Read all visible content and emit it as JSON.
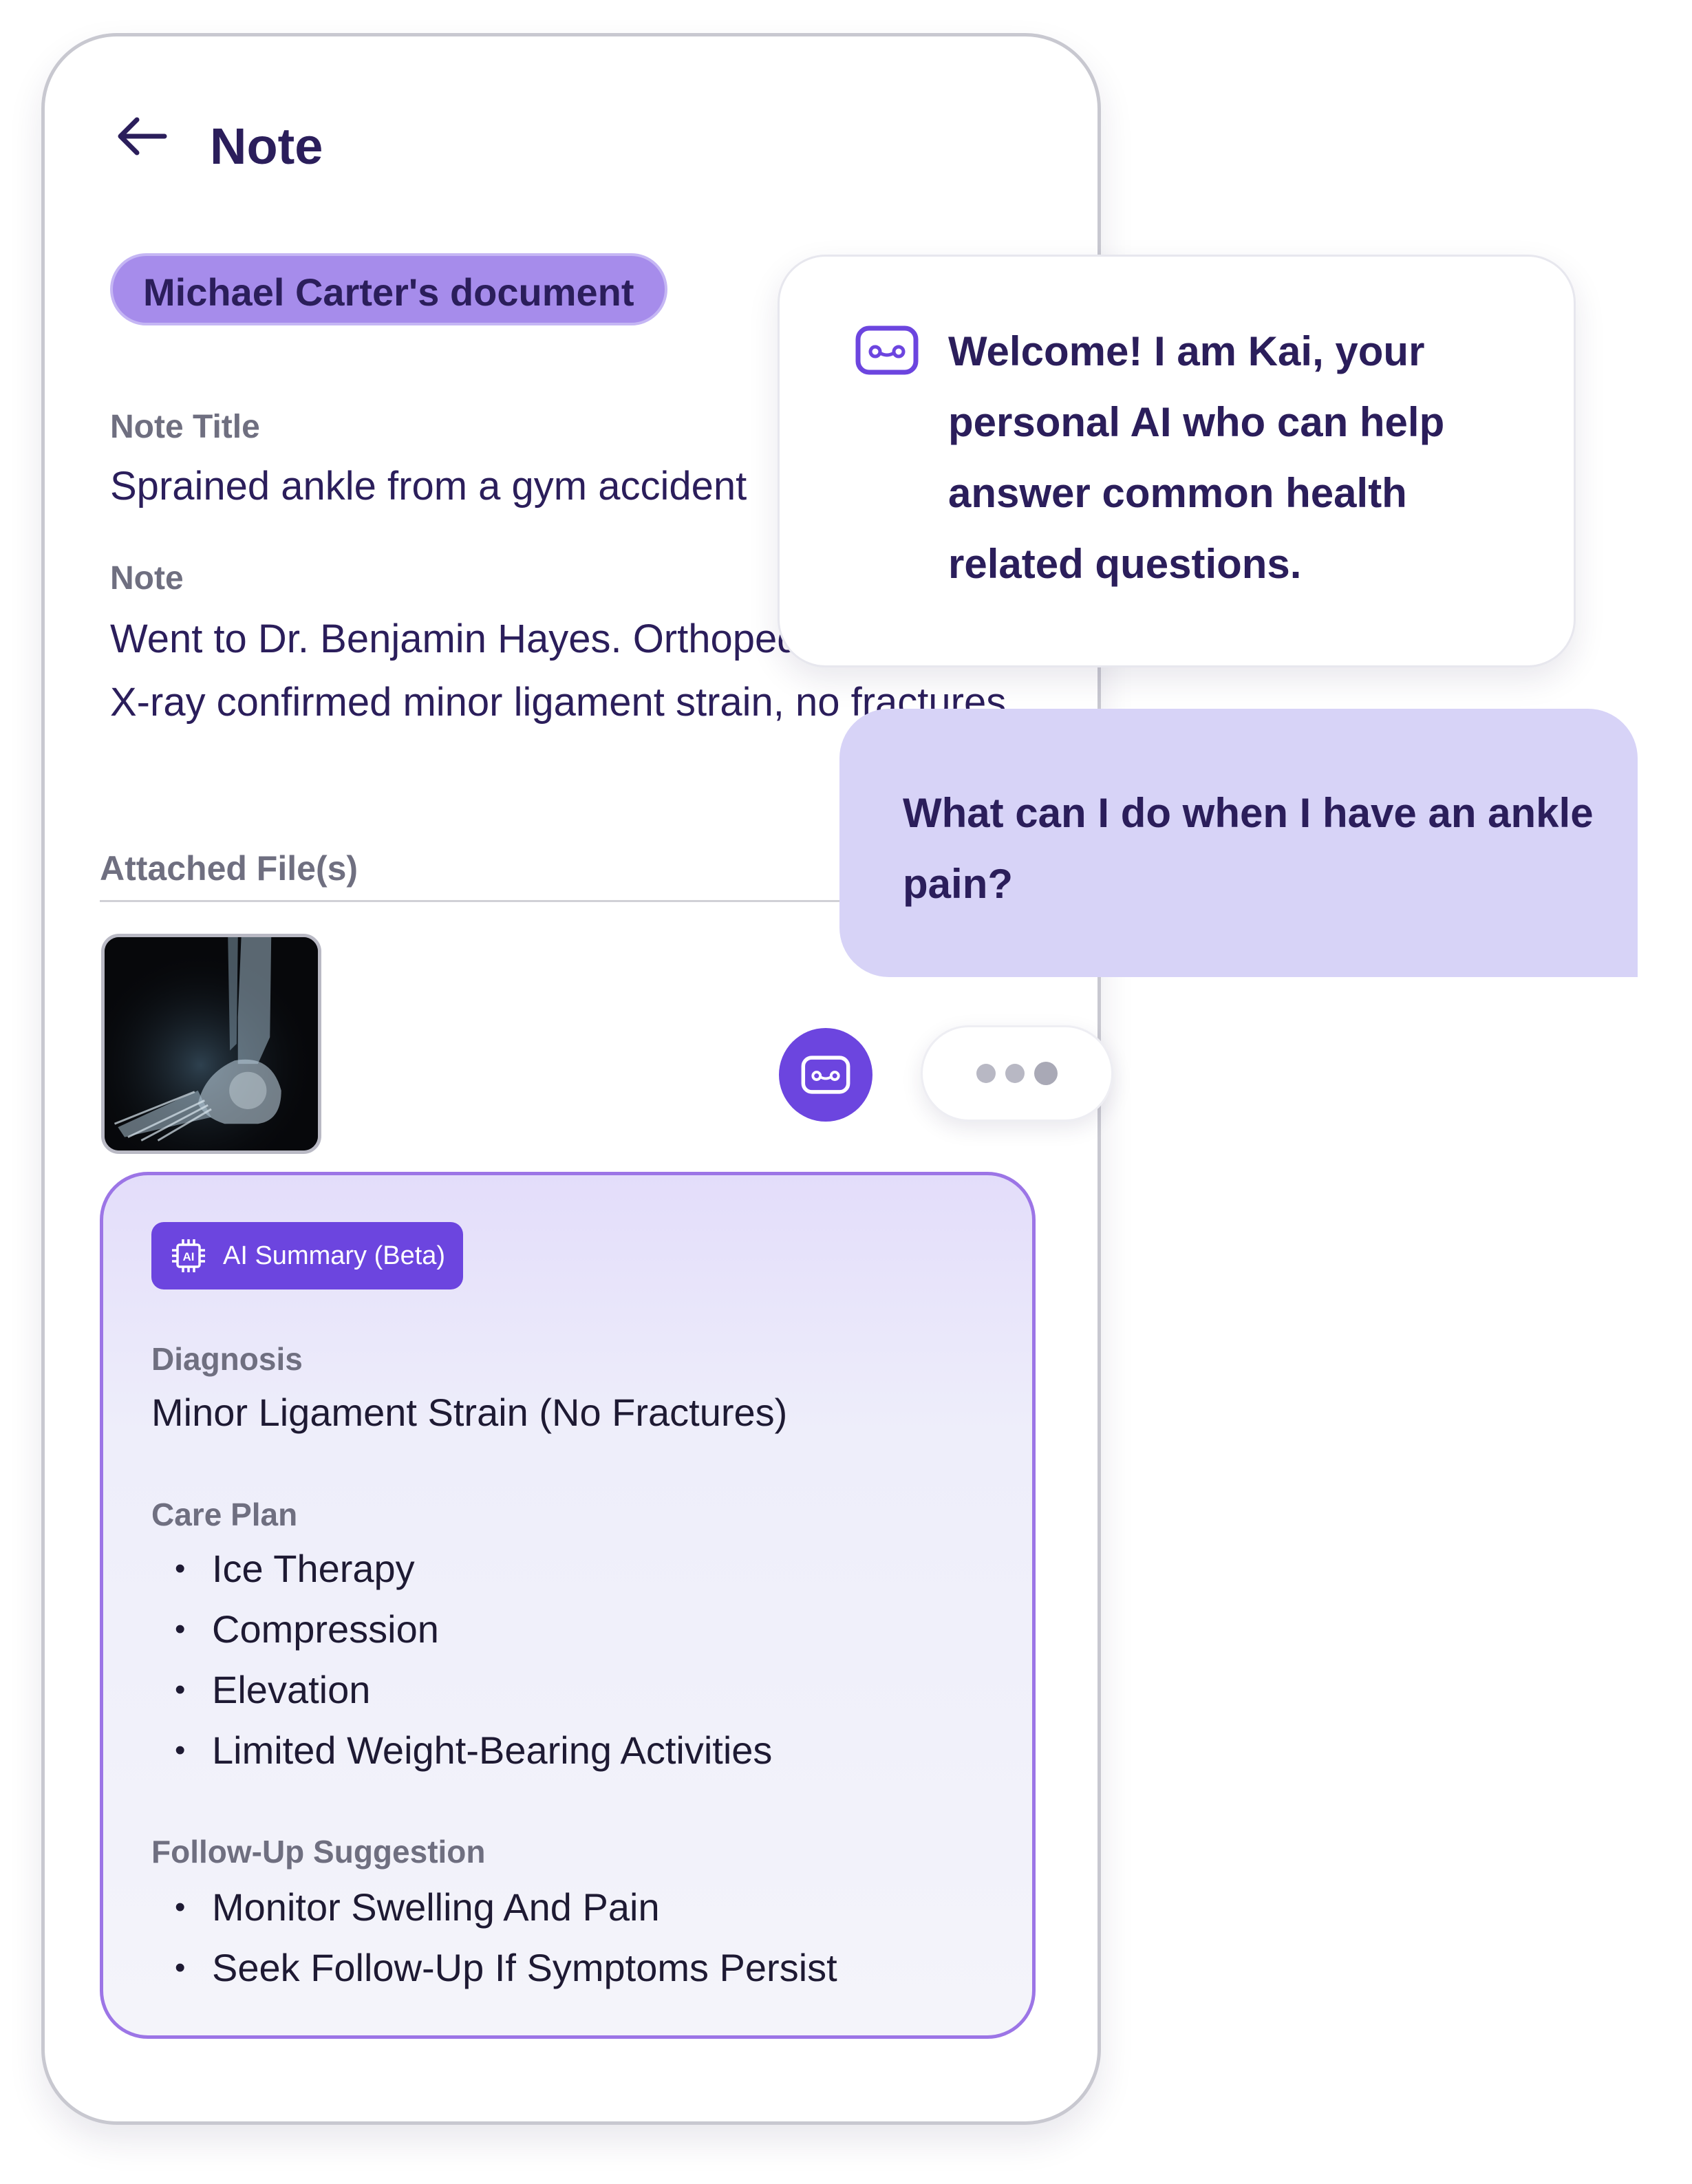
{
  "header": {
    "title": "Note",
    "back_icon": "arrow-left-icon"
  },
  "document_owner": "Michael Carter's document",
  "note": {
    "title_label": "Note Title",
    "title_value": "Sprained ankle from a gym accident",
    "note_label": "Note",
    "note_value": "Went to Dr. Benjamin Hayes.  Orthopedic Specialist.  X-ray confirmed minor ligament strain, no fractures."
  },
  "attachments": {
    "label": "Attached File(s)",
    "files": [
      "ankle-xray-thumbnail"
    ]
  },
  "ai_summary": {
    "badge_label": "AI Summary (Beta)",
    "diagnosis_label": "Diagnosis",
    "diagnosis_value": "Minor Ligament Strain (No Fractures)",
    "care_plan_label": "Care Plan",
    "care_plan": [
      "Ice Therapy",
      "Compression",
      "Elevation",
      "Limited Weight-Bearing Activities"
    ],
    "follow_up_label": "Follow-Up Suggestion",
    "follow_up": [
      "Monitor Swelling And Pain",
      "Seek Follow-Up If Symptoms Persist"
    ]
  },
  "chat": {
    "welcome": "Welcome! I am Kai, your personal AI who can help answer common health related questions.",
    "user_question": "What can I do when I have an ankle pain?",
    "typing": true
  },
  "colors": {
    "primary": "#6c45df",
    "text_dark": "#2b1e5b",
    "pill_bg": "#a68ceb",
    "question_bubble": "#d7d3f7",
    "muted": "#6f6f80"
  }
}
